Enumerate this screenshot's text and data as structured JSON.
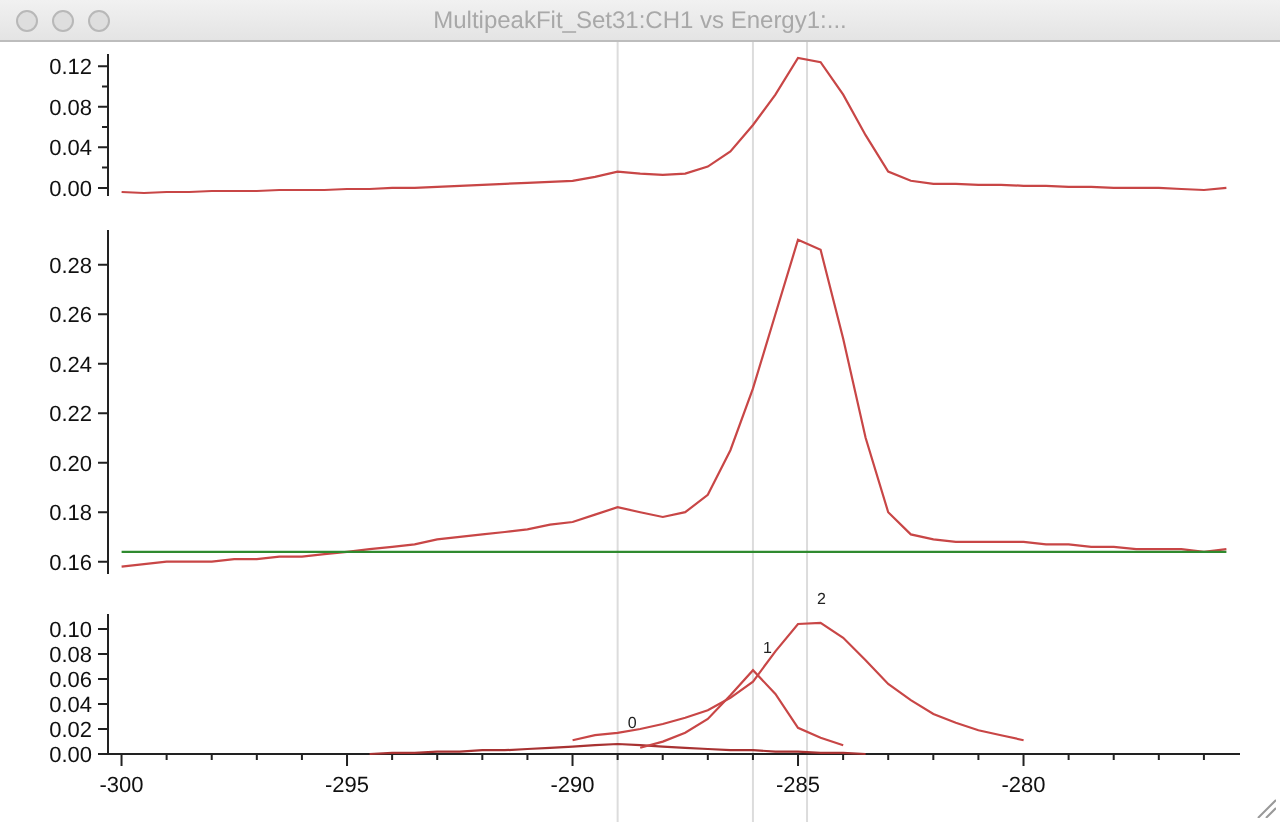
{
  "window": {
    "title": "MultipeakFit_Set31:CH1 vs Energy1:..."
  },
  "panels": [
    {
      "kind": "residual",
      "chart_data": {
        "type": "line",
        "series": [
          {
            "color": "#c84646",
            "values": [
              -0.004,
              -0.005,
              -0.004,
              -0.004,
              -0.003,
              -0.003,
              -0.003,
              -0.002,
              -0.002,
              -0.002,
              -0.001,
              -0.001,
              0,
              0,
              0.001,
              0.002,
              0.003,
              0.004,
              0.005,
              0.006,
              0.007,
              0.011,
              0.016,
              0.014,
              0.013,
              0.014,
              0.021,
              0.036,
              0.062,
              0.092,
              0.128,
              0.124,
              0.092,
              0.052,
              0.016,
              0.007,
              0.004,
              0.004,
              0.003,
              0.003,
              0.002,
              0.002,
              0.001,
              0.001,
              0,
              0,
              0,
              -0.001,
              -0.002,
              0
            ]
          }
        ],
        "ylim": [
          -0.008,
          0.132
        ],
        "yticks": [
          {
            "value": 0,
            "label": "0.00"
          },
          {
            "value": 0.04,
            "label": "0.04"
          },
          {
            "value": 0.08,
            "label": "0.08"
          },
          {
            "value": 0.12,
            "label": "0.12"
          }
        ]
      }
    },
    {
      "kind": "data",
      "chart_data": {
        "type": "line",
        "series": [
          {
            "color": "#c84646",
            "values": [
              0.158,
              0.159,
              0.16,
              0.16,
              0.16,
              0.161,
              0.161,
              0.162,
              0.162,
              0.163,
              0.164,
              0.165,
              0.166,
              0.167,
              0.169,
              0.17,
              0.171,
              0.172,
              0.173,
              0.175,
              0.176,
              0.179,
              0.182,
              0.18,
              0.178,
              0.18,
              0.187,
              0.205,
              0.23,
              0.26,
              0.29,
              0.286,
              0.25,
              0.21,
              0.18,
              0.171,
              0.169,
              0.168,
              0.168,
              0.168,
              0.168,
              0.167,
              0.167,
              0.166,
              0.166,
              0.165,
              0.165,
              0.165,
              0.164,
              0.165
            ]
          },
          {
            "color": "#2f8a2f",
            "values": [
              0.164,
              0.164,
              0.164,
              0.164,
              0.164,
              0.164,
              0.164,
              0.164,
              0.164,
              0.164,
              0.164,
              0.164,
              0.164,
              0.164,
              0.164,
              0.164,
              0.164,
              0.164,
              0.164,
              0.164,
              0.164,
              0.164,
              0.164,
              0.164,
              0.164,
              0.164,
              0.164,
              0.164,
              0.164,
              0.164,
              0.164,
              0.164,
              0.164,
              0.164,
              0.164,
              0.164,
              0.164,
              0.164,
              0.164,
              0.164,
              0.164,
              0.164,
              0.164,
              0.164,
              0.164,
              0.164,
              0.164,
              0.164,
              0.164,
              0.164
            ]
          }
        ],
        "ylim": [
          0.155,
          0.294
        ],
        "yticks": [
          {
            "value": 0.16,
            "label": "0.16"
          },
          {
            "value": 0.18,
            "label": "0.18"
          },
          {
            "value": 0.2,
            "label": "0.20"
          },
          {
            "value": 0.22,
            "label": "0.22"
          },
          {
            "value": 0.24,
            "label": "0.24"
          },
          {
            "value": 0.26,
            "label": "0.26"
          },
          {
            "value": 0.28,
            "label": "0.28"
          }
        ]
      }
    },
    {
      "kind": "peaks",
      "chart_data": {
        "type": "line",
        "x": [
          -294.5,
          -294,
          -293.5,
          -293,
          -292.5,
          -292,
          -291.5,
          -291,
          -290.5,
          -290,
          -289.5,
          -289,
          -288.5,
          -288,
          -287.5,
          -287,
          -286.5,
          -286,
          -285.5,
          -285,
          -284.5,
          -284,
          -283.5,
          -283,
          -282.5,
          -282,
          -281.5,
          -281,
          -280.5,
          -280
        ],
        "series": [
          {
            "color": "#a83232",
            "values": [
              0,
              0.001,
              0.001,
              0.002,
              0.002,
              0.003,
              0.003,
              0.004,
              0.005,
              0.006,
              0.007,
              0.008,
              0.007,
              0.006,
              0.005,
              0.004,
              0.003,
              0.003,
              0.002,
              0.002,
              0.001,
              0.001,
              0,
              null,
              null,
              null,
              null,
              null,
              null,
              null
            ]
          },
          {
            "color": "#c84646",
            "values": [
              null,
              null,
              null,
              null,
              null,
              null,
              null,
              null,
              null,
              null,
              null,
              null,
              0.005,
              0.01,
              0.017,
              0.028,
              0.047,
              0.067,
              0.048,
              0.021,
              0.013,
              0.007,
              null,
              null,
              null,
              null,
              null,
              null,
              null,
              null
            ]
          },
          {
            "color": "#c84646",
            "values": [
              null,
              null,
              null,
              null,
              null,
              null,
              null,
              null,
              null,
              0.011,
              0.015,
              0.017,
              0.02,
              0.024,
              0.029,
              0.035,
              0.045,
              0.058,
              0.082,
              0.104,
              0.105,
              0.093,
              0.075,
              0.056,
              0.043,
              0.032,
              0.025,
              0.019,
              0.015,
              0.011
            ]
          }
        ],
        "xlim": [
          -300.3,
          -275.2
        ],
        "ylim": [
          0,
          0.112
        ],
        "xticks": [
          -300,
          -295,
          -290,
          -285,
          -280
        ],
        "yticks": [
          {
            "value": 0,
            "label": "0.00"
          },
          {
            "value": 0.02,
            "label": "0.02"
          },
          {
            "value": 0.04,
            "label": "0.04"
          },
          {
            "value": 0.06,
            "label": "0.06"
          },
          {
            "value": 0.08,
            "label": "0.08"
          },
          {
            "value": 0.1,
            "label": "0.10"
          }
        ],
        "annotations": [
          {
            "x": -289,
            "y": 0.01,
            "text": "0"
          },
          {
            "x": -286,
            "y": 0.07,
            "text": "1"
          },
          {
            "x": -284.8,
            "y": 0.109,
            "text": "2"
          }
        ]
      }
    }
  ]
}
